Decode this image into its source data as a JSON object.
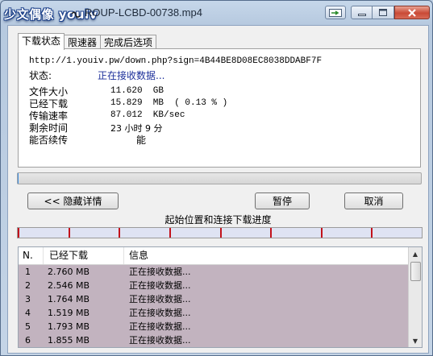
{
  "titlebar": {
    "logo_text": "少文偶像 youiv",
    "title": "ROUP-LCBD-00738.mp4"
  },
  "tabs": [
    {
      "label": "下载状态",
      "active": true
    },
    {
      "label": "限速器",
      "active": false
    },
    {
      "label": "完成后选项",
      "active": false
    }
  ],
  "status": {
    "url": "http://1.youiv.pw/down.php?sign=4B44BE8D08EC8038DDABF7F",
    "state_label": "状态:",
    "state_value": "正在接收数据...",
    "file_size_label": "文件大小",
    "file_size_value": "11.620  GB",
    "downloaded_label": "已经下载",
    "downloaded_value": "15.829  MB  ( 0.13 % )",
    "speed_label": "传输速率",
    "speed_value": "87.012  KB/sec",
    "remaining_label": "剩余时间",
    "remaining_value": "23 小时 9 分",
    "resume_label": "能否续传",
    "resume_value": "能"
  },
  "overall_progress_percent": 0.13,
  "buttons": {
    "hide_details": "<< 隐藏详情",
    "pause": "暂停",
    "cancel": "取消"
  },
  "segments_caption": "起始位置和连接下载进度",
  "segment_count": 8,
  "list": {
    "headers": [
      "N.",
      "已经下载",
      "信息"
    ],
    "rows": [
      {
        "n": "1",
        "downloaded": "2.760  MB",
        "info": "正在接收数据..."
      },
      {
        "n": "2",
        "downloaded": "2.546  MB",
        "info": "正在接收数据..."
      },
      {
        "n": "3",
        "downloaded": "1.764  MB",
        "info": "正在接收数据..."
      },
      {
        "n": "4",
        "downloaded": "1.519  MB",
        "info": "正在接收数据..."
      },
      {
        "n": "5",
        "downloaded": "1.793  MB",
        "info": "正在接收数据..."
      },
      {
        "n": "6",
        "downloaded": "1.855  MB",
        "info": "正在接收数据..."
      }
    ]
  },
  "colors": {
    "row_background": "#c2b3bf",
    "segment_marker": "#c2121b",
    "status_text": "#1c2f9a",
    "close_button": "#c94a36"
  },
  "icons": {
    "tray": "arrow-to-tray-icon",
    "minimize": "minimize-icon",
    "maximize": "maximize-icon",
    "close": "close-icon"
  }
}
